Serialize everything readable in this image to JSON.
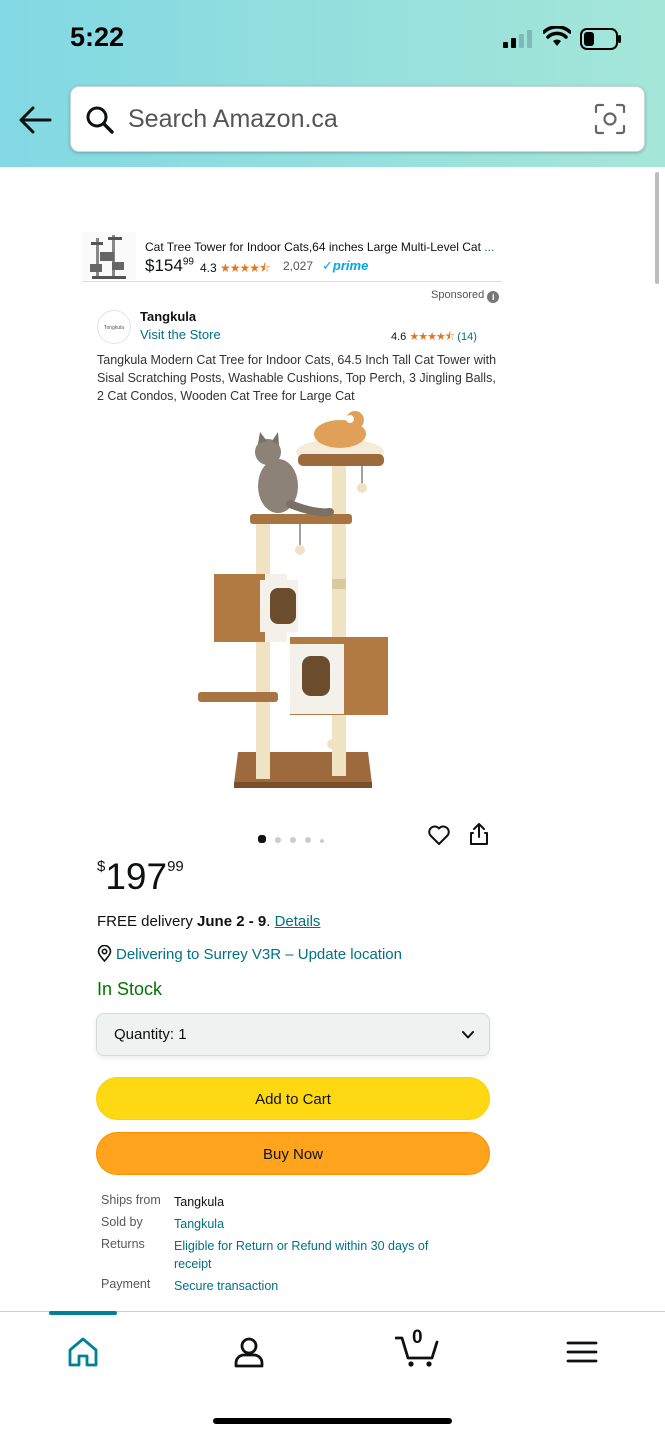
{
  "status_bar": {
    "time": "5:22"
  },
  "search": {
    "placeholder": "Search Amazon.ca"
  },
  "sponsored_product": {
    "title": "Cat Tree Tower for Indoor Cats,64 inches Large Multi-Level Cat",
    "title_ellipsis": " ...",
    "price_whole": "$154",
    "price_fraction": "99",
    "rating": "4.3",
    "stars": "★★★★⯪",
    "rating_count": "2,027",
    "prime": "✓prime"
  },
  "sponsored_label": "Sponsored",
  "brand": {
    "logo_text": "Tongkula",
    "name": "Tangkula",
    "visit_store": "Visit the Store",
    "rating": "4.6",
    "stars": "★★★★⯪",
    "count": "(14)"
  },
  "product": {
    "title": "Tangkula Modern Cat Tree for Indoor Cats, 64.5 Inch Tall Cat Tower with Sisal Scratching Posts, Washable Cushions, Top Perch, 3 Jingling Balls, 2 Cat Condos, Wooden Cat Tree for Large Cat",
    "image_count": 5,
    "active_image": 0,
    "price_currency": "$",
    "price_whole": "197",
    "price_fraction": "99"
  },
  "delivery": {
    "prefix": "FREE delivery ",
    "dates": "June 2 - 9",
    "separator": ". ",
    "details_link": "Details"
  },
  "location": {
    "text": "Delivering to Surrey V3R – Update location"
  },
  "stock": "In Stock",
  "quantity": {
    "label": "Quantity: 1"
  },
  "buttons": {
    "add_to_cart": "Add to Cart",
    "buy_now": "Buy Now"
  },
  "info": {
    "ships_from_key": "Ships from",
    "ships_from_val": "Tangkula",
    "sold_by_key": "Sold by",
    "sold_by_val": "Tangkula",
    "returns_key": "Returns",
    "returns_val": "Eligible for Return or Refund within 30 days of receipt",
    "payment_key": "Payment",
    "payment_val": "Secure transaction"
  },
  "bottom_nav": {
    "active": "home",
    "cart_count": "0",
    "items": [
      "home-icon",
      "account-icon",
      "cart-icon",
      "menu-icon"
    ]
  },
  "colors": {
    "header_gradient_start": "#82d8e3",
    "header_gradient_end": "#a5e6d8",
    "link": "#007185",
    "in_stock": "#007600",
    "add_to_cart": "#ffd814",
    "buy_now": "#ffa41c",
    "nav_active": "#008296"
  }
}
